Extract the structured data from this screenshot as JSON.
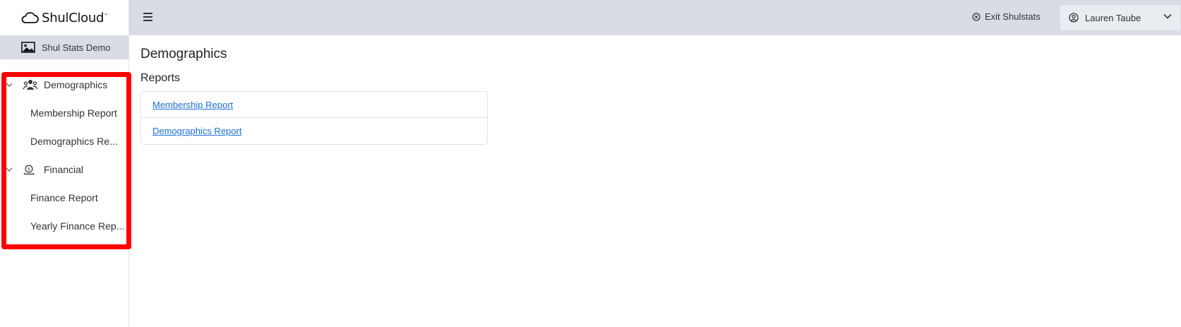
{
  "app": {
    "logo_text": "ShulCloud",
    "logo_mark": "™"
  },
  "sidebar": {
    "org_name": "Shul Stats Demo",
    "groups": [
      {
        "label": "Demographics",
        "icon": "people-icon",
        "items": [
          {
            "label": "Membership Report"
          },
          {
            "label": "Demographics Re..."
          }
        ]
      },
      {
        "label": "Financial",
        "icon": "money-icon",
        "items": [
          {
            "label": "Finance Report"
          },
          {
            "label": "Yearly Finance Rep..."
          }
        ]
      }
    ]
  },
  "topbar": {
    "exit_label": "Exit Shulstats",
    "user_name": "Lauren Taube"
  },
  "main": {
    "title": "Demographics",
    "section": "Reports",
    "links": [
      {
        "label": "Membership Report"
      },
      {
        "label": "Demographics Report"
      }
    ]
  },
  "colors": {
    "topbar_bg": "#d8dde5",
    "link": "#1a6fd8",
    "highlight": "#ff0000"
  }
}
